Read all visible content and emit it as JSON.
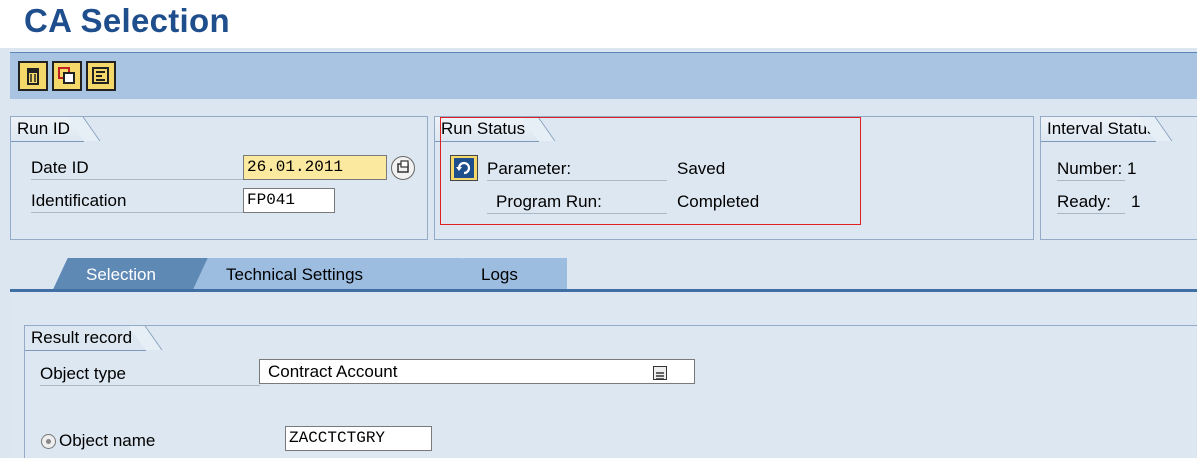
{
  "window": {
    "title": "CA Selection"
  },
  "toolbar": {
    "buttons": [
      "delete-icon",
      "copy-icon",
      "list-icon"
    ]
  },
  "run_id": {
    "header": "Run ID",
    "date_label": "Date ID",
    "date_value": "26.01.2011",
    "ident_label": "Identification",
    "ident_value": "FP041"
  },
  "run_status": {
    "header": "Run Status",
    "param_label": "Parameter:",
    "param_value": "Saved",
    "prog_label": "Program Run:",
    "prog_value": "Completed"
  },
  "interval_status": {
    "header": "Interval Status",
    "number_label": "Number:",
    "number_value": "1",
    "ready_label": "Ready:",
    "ready_value": "1"
  },
  "tabs": [
    {
      "label": "Selection",
      "active": true
    },
    {
      "label": "Technical Settings",
      "active": false
    },
    {
      "label": "Logs",
      "active": false
    }
  ],
  "result_record": {
    "header": "Result record",
    "object_type_label": "Object type",
    "object_type_value": "Contract Account",
    "object_name_label": "Object name",
    "object_name_value": "ZACCTCTGRY"
  },
  "colors": {
    "title": "#1f4e8c",
    "highlight_box": "#e02020",
    "active_tab": "#5f89b5"
  }
}
